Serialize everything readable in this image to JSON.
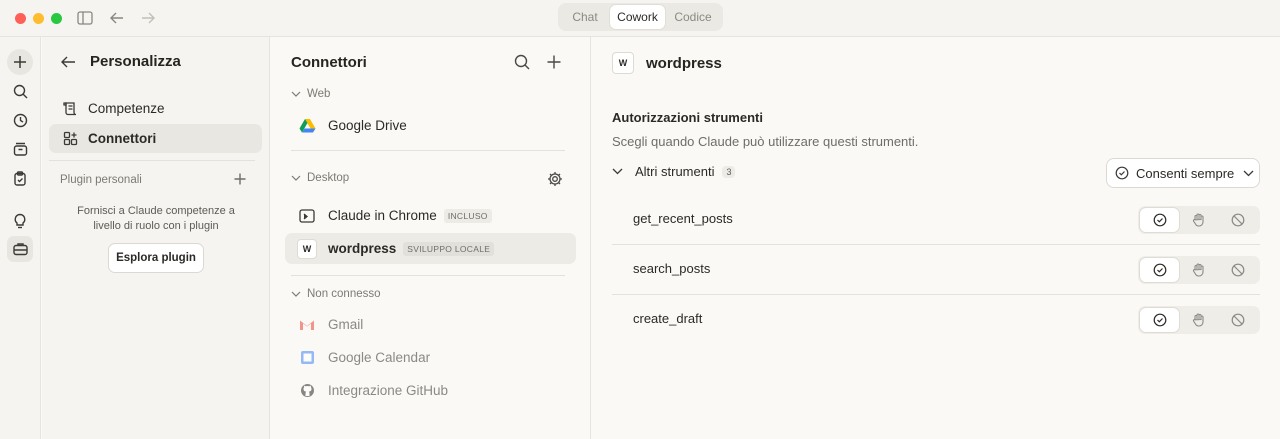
{
  "titlebar": {
    "tabs": [
      {
        "label": "Chat",
        "active": false
      },
      {
        "label": "Cowork",
        "active": true
      },
      {
        "label": "Codice",
        "active": false
      }
    ]
  },
  "rail": {
    "icons": [
      "plus-icon",
      "search-icon",
      "clock-icon",
      "archive-icon",
      "clipboard-icon",
      "lightbulb-icon",
      "briefcase-icon"
    ]
  },
  "settings": {
    "title": "Personalizza",
    "items": [
      {
        "label": "Competenze",
        "icon": "scroll-icon"
      },
      {
        "label": "Connettori",
        "icon": "grid-plus-icon"
      }
    ],
    "plugins_label": "Plugin personali",
    "plugins_desc": "Fornisci a Claude competenze a livello di ruolo con i plugin",
    "explore_label": "Esplora plugin"
  },
  "connectors": {
    "title": "Connettori",
    "groups": [
      {
        "label": "Web",
        "items": [
          {
            "name": "Google Drive",
            "badge": "",
            "icon": "google-drive-icon"
          }
        ]
      },
      {
        "label": "Desktop",
        "items": [
          {
            "name": "Claude in Chrome",
            "badge": "INCLUSO",
            "icon": "chrome-window-icon"
          },
          {
            "name": "wordpress",
            "badge": "SVILUPPO LOCALE",
            "icon": "w-letter-icon"
          }
        ]
      },
      {
        "label": "Non connesso",
        "items": [
          {
            "name": "Gmail",
            "badge": "",
            "icon": "gmail-icon"
          },
          {
            "name": "Google Calendar",
            "badge": "",
            "icon": "google-calendar-icon"
          },
          {
            "name": "Integrazione GitHub",
            "badge": "",
            "icon": "github-icon"
          }
        ]
      }
    ]
  },
  "detail": {
    "icon_letter": "W",
    "title": "wordpress",
    "permissions_title": "Autorizzazioni strumenti",
    "permissions_desc": "Scegli quando Claude può utilizzare questi strumenti.",
    "group_label": "Altri strumenti",
    "group_count": "3",
    "allow_all_label": "Consenti sempre",
    "tools": [
      {
        "name": "get_recent_posts",
        "permission": "allow"
      },
      {
        "name": "search_posts",
        "permission": "allow"
      },
      {
        "name": "create_draft",
        "permission": "allow"
      }
    ]
  }
}
